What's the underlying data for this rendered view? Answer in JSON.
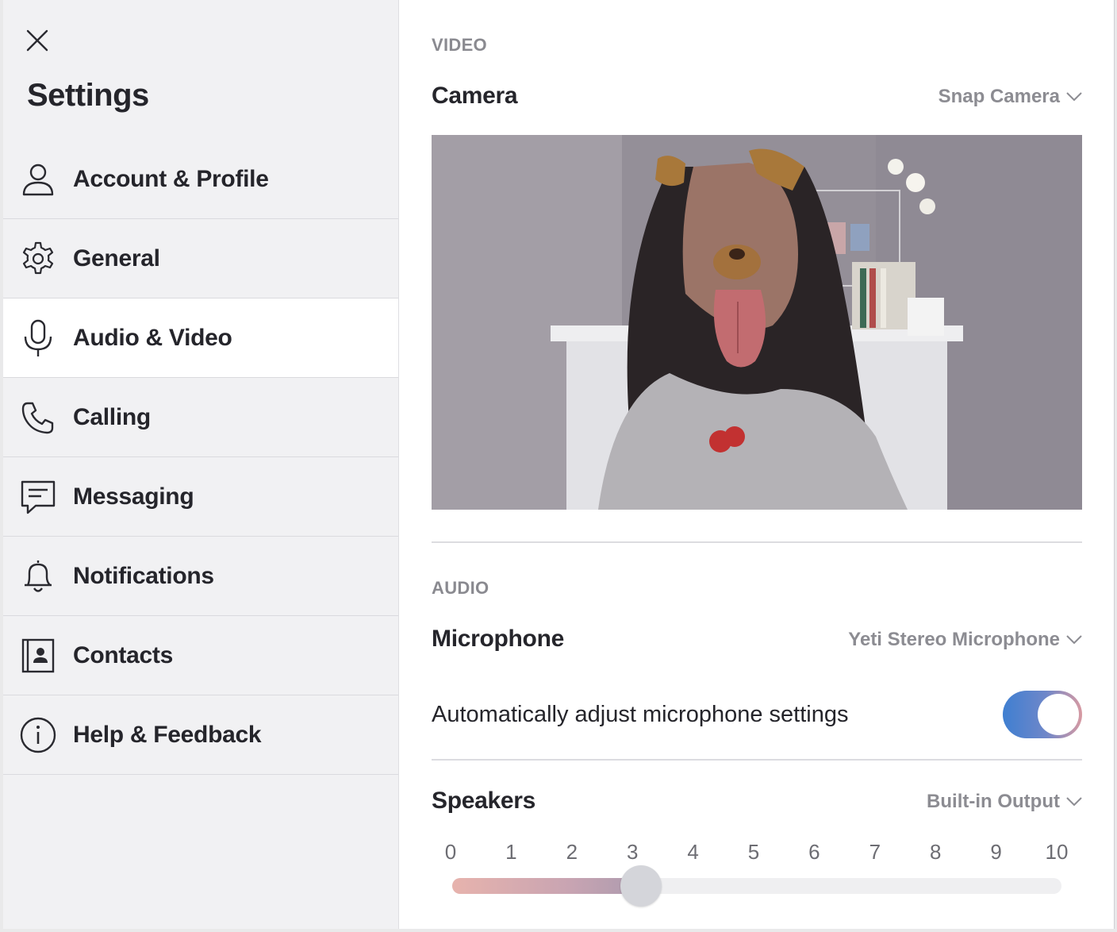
{
  "sidebar": {
    "title": "Settings",
    "items": [
      {
        "label": "Account & Profile",
        "icon": "person-icon",
        "active": false
      },
      {
        "label": "General",
        "icon": "gear-icon",
        "active": false
      },
      {
        "label": "Audio & Video",
        "icon": "microphone-icon",
        "active": true
      },
      {
        "label": "Calling",
        "icon": "phone-icon",
        "active": false
      },
      {
        "label": "Messaging",
        "icon": "message-icon",
        "active": false
      },
      {
        "label": "Notifications",
        "icon": "bell-icon",
        "active": false
      },
      {
        "label": "Contacts",
        "icon": "contact-card-icon",
        "active": false
      },
      {
        "label": "Help & Feedback",
        "icon": "info-icon",
        "active": false
      }
    ]
  },
  "video": {
    "heading": "VIDEO",
    "camera_label": "Camera",
    "camera_value": "Snap Camera"
  },
  "audio": {
    "heading": "AUDIO",
    "microphone_label": "Microphone",
    "microphone_value": "Yeti Stereo Microphone",
    "auto_adjust_label": "Automatically adjust microphone settings",
    "auto_adjust_on": true,
    "speakers_label": "Speakers",
    "speakers_value": "Built-in Output",
    "volume_ticks": [
      "0",
      "1",
      "2",
      "3",
      "4",
      "5",
      "6",
      "7",
      "8",
      "9",
      "10"
    ],
    "volume_level": 3.1
  },
  "colors": {
    "toggle_on": "#3f7fd1",
    "sidebar_bg": "#f1f1f3",
    "muted_text": "#8c8c92"
  }
}
